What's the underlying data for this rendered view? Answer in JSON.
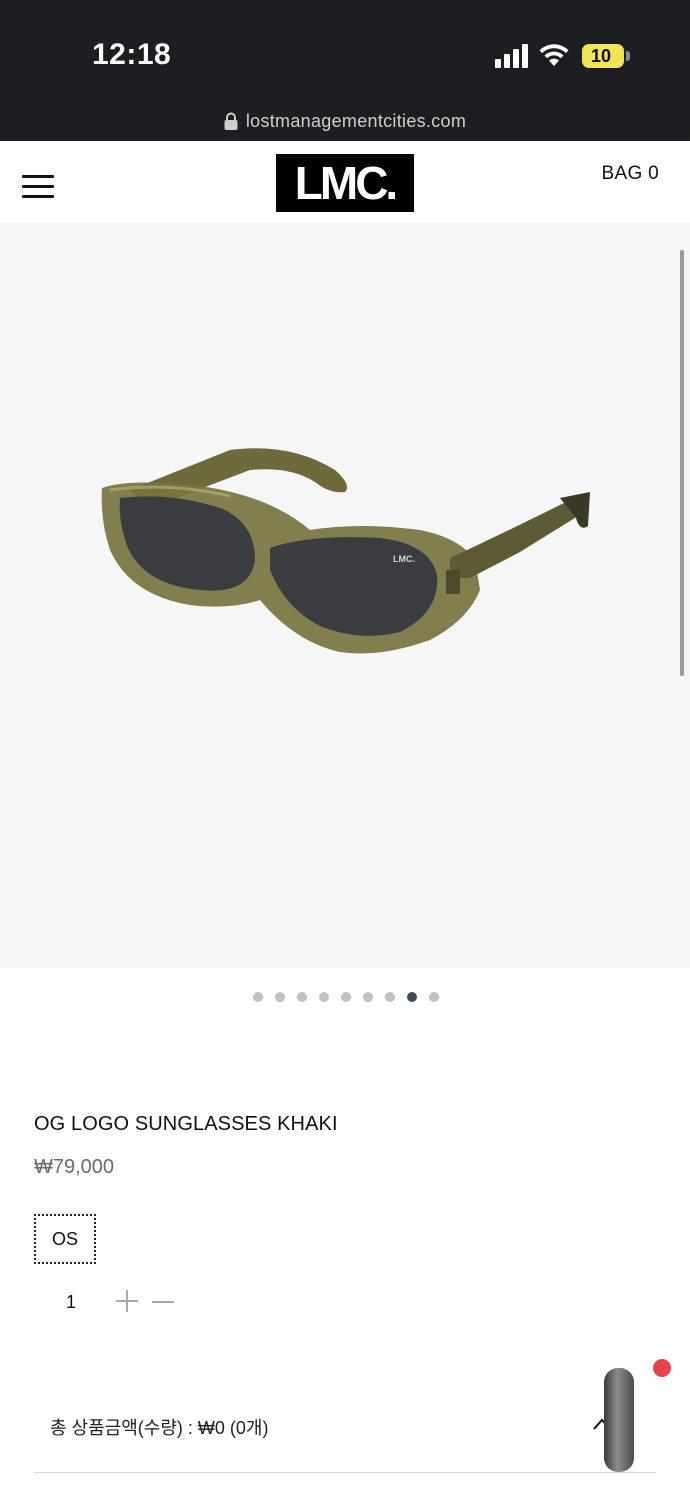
{
  "status_bar": {
    "time": "12:18",
    "battery": "10",
    "url": "lostmanagementcities.com"
  },
  "header": {
    "logo": "LMC.",
    "bag_label": "BAG 0"
  },
  "gallery": {
    "dot_count": 9,
    "active_index": 7
  },
  "product": {
    "name": "OG LOGO SUNGLASSES KHAKI",
    "price": "₩79,000",
    "option": "OS",
    "quantity": "1"
  },
  "summary": {
    "total_text": "총 상품금액(수량) : ₩0 (0개)"
  },
  "colors": {
    "status_bg": "#1c1e21",
    "gallery_bg": "#f6f6f6",
    "notification": "#e8424a",
    "active_dot": "#414a57"
  }
}
